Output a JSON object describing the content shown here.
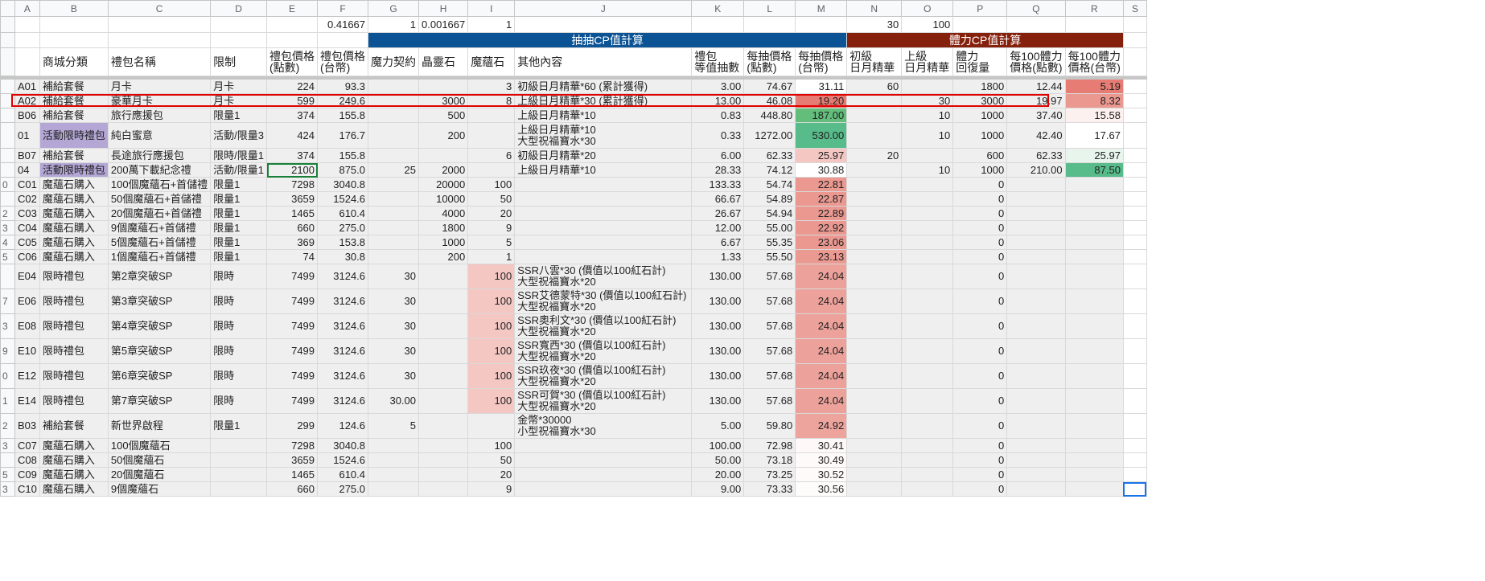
{
  "columns": [
    "A",
    "B",
    "C",
    "D",
    "E",
    "F",
    "G",
    "H",
    "I",
    "J",
    "K",
    "L",
    "M",
    "N",
    "O",
    "P",
    "Q",
    "R",
    "S"
  ],
  "top_row": [
    {
      "col": "F",
      "value": "0.41667"
    },
    {
      "col": "G",
      "value": "1"
    },
    {
      "col": "H",
      "value": "0.001667"
    },
    {
      "col": "I",
      "value": "1"
    },
    {
      "col": "N",
      "value": "30"
    },
    {
      "col": "O",
      "value": "100"
    }
  ],
  "group_headers": {
    "gacha": "抽抽CP值計算",
    "stamina": "體力CP值計算"
  },
  "headers": [
    "",
    "商城分類",
    "禮包名稱",
    "限制",
    "禮包價格\n(點數)",
    "禮包價格\n(台幣)",
    "魔力契約",
    "晶靈石",
    "魔蘊石",
    "其他內容",
    "禮包\n等值抽數",
    "每抽價格\n(點數)",
    "每抽價格\n(台幣)",
    "初級\n日月精華",
    "上級\n日月精華",
    "體力\n回復量",
    "每100體力\n價格(點數)",
    "每100體力\n價格(台幣)",
    ""
  ],
  "colors": {
    "blue_band": "#0b5394",
    "red_band": "#85200c",
    "purple_cell": "#b4a7d6",
    "highlight_border": "#e00000"
  },
  "rows": [
    {
      "n": "",
      "cells": [
        "A01",
        "補給套餐",
        "月卡",
        "月卡",
        "224",
        "93.3",
        "",
        "",
        "3",
        "初級日月精華*60 (累計獲得)",
        "3.00",
        "74.67",
        "31.11",
        "60",
        "",
        "1800",
        "12.44",
        "5.19",
        ""
      ],
      "h": 18,
      "bg": {
        "12": "#ffffff",
        "17": "#e67c73"
      }
    },
    {
      "n": "",
      "cells": [
        "A02",
        "補給套餐",
        "豪華月卡",
        "月卡",
        "599",
        "249.6",
        "",
        "3000",
        "8",
        "上級日月精華*30 (累計獲得)",
        "13.00",
        "46.08",
        "19.20",
        "",
        "30",
        "3000",
        "19.97",
        "8.32",
        ""
      ],
      "h": 18,
      "bg": {
        "12": "#e67c73",
        "17": "#ea9890"
      }
    },
    {
      "n": "",
      "cells": [
        "B06",
        "補給套餐",
        "旅行應援包",
        "限量1",
        "374",
        "155.8",
        "",
        "500",
        "",
        "上級日月精華*10",
        "0.83",
        "448.80",
        "187.00",
        "",
        "10",
        "1000",
        "37.40",
        "15.58",
        ""
      ],
      "h": 18,
      "bg": {
        "12": "#63be7b",
        "17": "#fdf1f0"
      }
    },
    {
      "n": "",
      "cells": [
        "01",
        "活動限時禮包",
        "純白蜜意",
        "活動/限量3",
        "424",
        "176.7",
        "",
        "200",
        "",
        "上級日月精華*10\n大型祝福寶水*30",
        "0.33",
        "1272.00",
        "530.00",
        "",
        "10",
        "1000",
        "42.40",
        "17.67",
        ""
      ],
      "h": 32,
      "bg": {
        "1": "#b4a7d6",
        "12": "#57bb8a",
        "17": "#ffffff"
      }
    },
    {
      "n": "",
      "cells": [
        "B07",
        "補給套餐",
        "長途旅行應援包",
        "限時/限量1",
        "374",
        "155.8",
        "",
        "",
        "6",
        "初級日月精華*20",
        "6.00",
        "62.33",
        "25.97",
        "20",
        "",
        "600",
        "62.33",
        "25.97",
        ""
      ],
      "h": 18,
      "bg": {
        "12": "#f4c7c3",
        "17": "#e8f5ec"
      }
    },
    {
      "n": "",
      "cells": [
        "04",
        "活動限時禮包",
        "200萬下載紀念禮",
        "活動/限量1",
        "2100",
        "875.0",
        "25",
        "2000",
        "",
        "上級日月精華*10",
        "28.33",
        "74.12",
        "30.88",
        "",
        "10",
        "1000",
        "210.00",
        "87.50",
        ""
      ],
      "h": 18,
      "bg": {
        "1": "#b4a7d6",
        "12": "#ffffff",
        "17": "#57bb8a"
      },
      "sel": 4
    },
    {
      "n": "0",
      "cells": [
        "C01",
        "魔蘊石購入",
        "100個魔蘊石+首儲禮",
        "限量1",
        "7298",
        "3040.8",
        "",
        "20000",
        "100",
        "",
        "133.33",
        "54.74",
        "22.81",
        "",
        "",
        "0",
        "",
        "",
        ""
      ],
      "h": 18,
      "bg": {
        "12": "#ea9890"
      }
    },
    {
      "n": "",
      "cells": [
        "C02",
        "魔蘊石購入",
        "50個魔蘊石+首儲禮",
        "限量1",
        "3659",
        "1524.6",
        "",
        "10000",
        "50",
        "",
        "66.67",
        "54.89",
        "22.87",
        "",
        "",
        "0",
        "",
        "",
        ""
      ],
      "h": 18,
      "bg": {
        "12": "#ea9890"
      }
    },
    {
      "n": "2",
      "cells": [
        "C03",
        "魔蘊石購入",
        "20個魔蘊石+首儲禮",
        "限量1",
        "1465",
        "610.4",
        "",
        "4000",
        "20",
        "",
        "26.67",
        "54.94",
        "22.89",
        "",
        "",
        "0",
        "",
        "",
        ""
      ],
      "h": 18,
      "bg": {
        "12": "#ea9890"
      }
    },
    {
      "n": "3",
      "cells": [
        "C04",
        "魔蘊石購入",
        "9個魔蘊石+首儲禮",
        "限量1",
        "660",
        "275.0",
        "",
        "1800",
        "9",
        "",
        "12.00",
        "55.00",
        "22.92",
        "",
        "",
        "0",
        "",
        "",
        ""
      ],
      "h": 18,
      "bg": {
        "12": "#ea9890"
      }
    },
    {
      "n": "4",
      "cells": [
        "C05",
        "魔蘊石購入",
        "5個魔蘊石+首儲禮",
        "限量1",
        "369",
        "153.8",
        "",
        "1000",
        "5",
        "",
        "6.67",
        "55.35",
        "23.06",
        "",
        "",
        "0",
        "",
        "",
        ""
      ],
      "h": 18,
      "bg": {
        "12": "#ea9890"
      }
    },
    {
      "n": "5",
      "cells": [
        "C06",
        "魔蘊石購入",
        "1個魔蘊石+首儲禮",
        "限量1",
        "74",
        "30.8",
        "",
        "200",
        "1",
        "",
        "1.33",
        "55.50",
        "23.13",
        "",
        "",
        "0",
        "",
        "",
        ""
      ],
      "h": 18,
      "bg": {
        "12": "#eb9a92"
      }
    },
    {
      "n": "",
      "cells": [
        "E04",
        "限時禮包",
        "第2章突破SP",
        "限時",
        "7499",
        "3124.6",
        "30",
        "",
        "100",
        "SSR八雲*30 (價值以100紅石計)\n大型祝福寶水*20",
        "130.00",
        "57.68",
        "24.04",
        "",
        "",
        "0",
        "",
        "",
        ""
      ],
      "h": 31,
      "bg": {
        "8": "#f4c7c3",
        "12": "#eca19a"
      }
    },
    {
      "n": "7",
      "cells": [
        "E06",
        "限時禮包",
        "第3章突破SP",
        "限時",
        "7499",
        "3124.6",
        "30",
        "",
        "100",
        "SSR艾德蒙特*30 (價值以100紅石計)\n大型祝福寶水*20",
        "130.00",
        "57.68",
        "24.04",
        "",
        "",
        "0",
        "",
        "",
        ""
      ],
      "h": 31,
      "bg": {
        "8": "#f4c7c3",
        "12": "#eca19a"
      }
    },
    {
      "n": "3",
      "cells": [
        "E08",
        "限時禮包",
        "第4章突破SP",
        "限時",
        "7499",
        "3124.6",
        "30",
        "",
        "100",
        "SSR奧利文*30 (價值以100紅石計)\n大型祝福寶水*20",
        "130.00",
        "57.68",
        "24.04",
        "",
        "",
        "0",
        "",
        "",
        ""
      ],
      "h": 31,
      "bg": {
        "8": "#f4c7c3",
        "12": "#eca19a"
      }
    },
    {
      "n": "9",
      "cells": [
        "E10",
        "限時禮包",
        "第5章突破SP",
        "限時",
        "7499",
        "3124.6",
        "30",
        "",
        "100",
        "SSR寬西*30 (價值以100紅石計)\n大型祝福寶水*20",
        "130.00",
        "57.68",
        "24.04",
        "",
        "",
        "0",
        "",
        "",
        ""
      ],
      "h": 31,
      "bg": {
        "8": "#f4c7c3",
        "12": "#eca19a"
      }
    },
    {
      "n": "0",
      "cells": [
        "E12",
        "限時禮包",
        "第6章突破SP",
        "限時",
        "7499",
        "3124.6",
        "30",
        "",
        "100",
        "SSR玖夜*30 (價值以100紅石計)\n大型祝福寶水*20",
        "130.00",
        "57.68",
        "24.04",
        "",
        "",
        "0",
        "",
        "",
        ""
      ],
      "h": 31,
      "bg": {
        "8": "#f4c7c3",
        "12": "#eca19a"
      }
    },
    {
      "n": "1",
      "cells": [
        "E14",
        "限時禮包",
        "第7章突破SP",
        "限時",
        "7499",
        "3124.6",
        "30.00",
        "",
        "100",
        "SSR可賀*30 (價值以100紅石計)\n大型祝福寶水*20",
        "130.00",
        "57.68",
        "24.04",
        "",
        "",
        "0",
        "",
        "",
        ""
      ],
      "h": 31,
      "bg": {
        "8": "#f4c7c3",
        "12": "#eca19a"
      }
    },
    {
      "n": "2",
      "cells": [
        "B03",
        "補給套餐",
        "新世界啟程",
        "限量1",
        "299",
        "124.6",
        "5",
        "",
        "",
        "金幣*30000\n小型祝福寶水*30",
        "5.00",
        "59.80",
        "24.92",
        "",
        "",
        "0",
        "",
        "",
        ""
      ],
      "h": 31,
      "bg": {
        "12": "#eda49d"
      }
    },
    {
      "n": "3",
      "cells": [
        "C07",
        "魔蘊石購入",
        "100個魔蘊石",
        "",
        "7298",
        "3040.8",
        "",
        "",
        "100",
        "",
        "100.00",
        "72.98",
        "30.41",
        "",
        "",
        "0",
        "",
        "",
        ""
      ],
      "h": 18,
      "bg": {
        "12": "#fef8f8"
      }
    },
    {
      "n": "",
      "cells": [
        "C08",
        "魔蘊石購入",
        "50個魔蘊石",
        "",
        "3659",
        "1524.6",
        "",
        "",
        "50",
        "",
        "50.00",
        "73.18",
        "30.49",
        "",
        "",
        "0",
        "",
        "",
        ""
      ],
      "h": 18,
      "bg": {
        "12": "#fefafa"
      }
    },
    {
      "n": "5",
      "cells": [
        "C09",
        "魔蘊石購入",
        "20個魔蘊石",
        "",
        "1465",
        "610.4",
        "",
        "",
        "20",
        "",
        "20.00",
        "73.25",
        "30.52",
        "",
        "",
        "0",
        "",
        "",
        ""
      ],
      "h": 18,
      "bg": {
        "12": "#fefafa"
      }
    },
    {
      "n": "3",
      "cells": [
        "C10",
        "魔蘊石購入",
        "9個魔蘊石",
        "",
        "660",
        "275.0",
        "",
        "",
        "9",
        "",
        "9.00",
        "73.33",
        "30.56",
        "",
        "",
        "0",
        "",
        "",
        ""
      ],
      "h": 18,
      "bg": {
        "12": "#fefbfb"
      },
      "active": 18
    }
  ]
}
